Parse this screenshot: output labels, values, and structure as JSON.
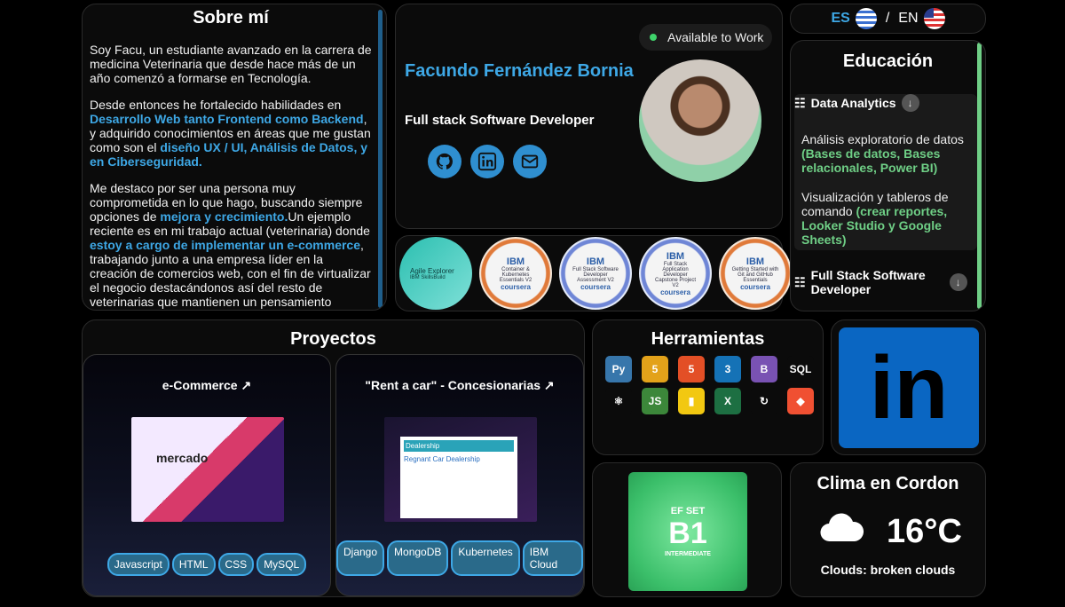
{
  "about": {
    "title": "Sobre mí",
    "p1": "Soy Facu, un estudiante avanzado en la carrera de medicina Veterinaria que desde hace más de un año comenzó a formarse en Tecnología.",
    "p2_a": "Desde entonces he fortalecido habilidades en ",
    "p2_hl1": "Desarrollo Web tanto Frontend como Backend",
    "p2_b": ", y adquirido conocimientos en áreas que me gustan como son el ",
    "p2_hl2": "diseño UX / UI, Análisis de Datos, y en Ciberseguridad.",
    "p3_a": "Me destaco por ser una persona muy comprometida en lo que hago, buscando siempre opciones de ",
    "p3_hl1": "mejora y crecimiento.",
    "p3_b": "Un ejemplo reciente es en mi trabajo actual (veterinaria) donde ",
    "p3_hl2": "estoy a cargo de implementar un e-commerce",
    "p3_c": ", trabajando junto a una empresa líder en la creación de comercios web, con el fin de virtualizar el negocio destacándonos así del resto de veterinarias que mantienen un pensamiento comercial anticuado."
  },
  "profile": {
    "status": "Available to Work",
    "name": "Facundo Fernández Bornia",
    "role": "Full stack Software Developer",
    "social": [
      "github-icon",
      "linkedin-icon",
      "mail-icon"
    ]
  },
  "badges": {
    "agile": {
      "title": "Agile Explorer",
      "sub": "IBM SkillsBuild"
    },
    "items": [
      {
        "provider": "IBM",
        "line": "Container & Kubernetes Essentials V2",
        "platform": "coursera",
        "ring": "#e07a3a"
      },
      {
        "provider": "IBM",
        "line": "Full Stack Software Developer Assessment V2",
        "platform": "coursera",
        "ring": "#6f86d6"
      },
      {
        "provider": "IBM",
        "line": "Full Stack Application Developer Capstone Project V2",
        "platform": "coursera",
        "ring": "#6f86d6"
      },
      {
        "provider": "IBM",
        "line": "Getting Started with Git and GitHub Essentials",
        "platform": "coursera",
        "ring": "#e07a3a"
      }
    ]
  },
  "lang": {
    "es": "ES",
    "sep": "/",
    "en": "EN"
  },
  "education": {
    "title": "Educación",
    "item1": "Data Analytics",
    "desc1_a": "Análisis exploratorio de datos ",
    "desc1_hl": "(Bases de datos, Bases relacionales, Power BI)",
    "desc2_a": "Visualización y tableros de comando ",
    "desc2_hl": "(crear reportes, Looker Studio y Google Sheets)",
    "item2": "Full Stack Software Developer"
  },
  "projects": {
    "title": "Proyectos",
    "items": [
      {
        "title": "e-Commerce",
        "tags": [
          "Javascript",
          "HTML",
          "CSS",
          "MySQL"
        ]
      },
      {
        "title": "\"Rent a car\" - Concesionarias",
        "tags": [
          "Django",
          "MongoDB",
          "Kubernetes",
          "IBM Cloud"
        ]
      }
    ],
    "shot1_brand": "mercado",
    "shot2_brand": "Dealership",
    "shot2_heading": "Regnant Car Dealership"
  },
  "tools": {
    "title": "Herramientas",
    "items": [
      {
        "icon": "python-icon",
        "label": "Py",
        "color": "#3776ab"
      },
      {
        "icon": "html5-icon",
        "label": "5",
        "color": "#e3a21a"
      },
      {
        "icon": "html5-icon",
        "label": "5",
        "color": "#e34f26"
      },
      {
        "icon": "css3-icon",
        "label": "3",
        "color": "#1572b6"
      },
      {
        "icon": "bootstrap-icon",
        "label": "B",
        "color": "#7952b3"
      },
      {
        "icon": "mysql-icon",
        "label": "SQL",
        "color": "#0b0b0b"
      },
      {
        "icon": "react-icon",
        "label": "⚛",
        "color": "#0b0b0b"
      },
      {
        "icon": "nodejs-icon",
        "label": "JS",
        "color": "#3c873a"
      },
      {
        "icon": "powerbi-icon",
        "label": "▮",
        "color": "#f2c811"
      },
      {
        "icon": "excel-icon",
        "label": "X",
        "color": "#1d6f42"
      },
      {
        "icon": "bitbucket-icon",
        "label": "↻",
        "color": "#0b0b0b"
      },
      {
        "icon": "git-icon",
        "label": "◆",
        "color": "#f05032"
      }
    ]
  },
  "linkedin": {
    "label": "in"
  },
  "efset": {
    "brand": "EF SET",
    "level": "B1",
    "sub": "INTERMEDIATE"
  },
  "weather": {
    "title": "Clima en Cordon",
    "temp": "16°C",
    "desc": "Clouds: broken clouds",
    "icon": "cloud-icon"
  }
}
